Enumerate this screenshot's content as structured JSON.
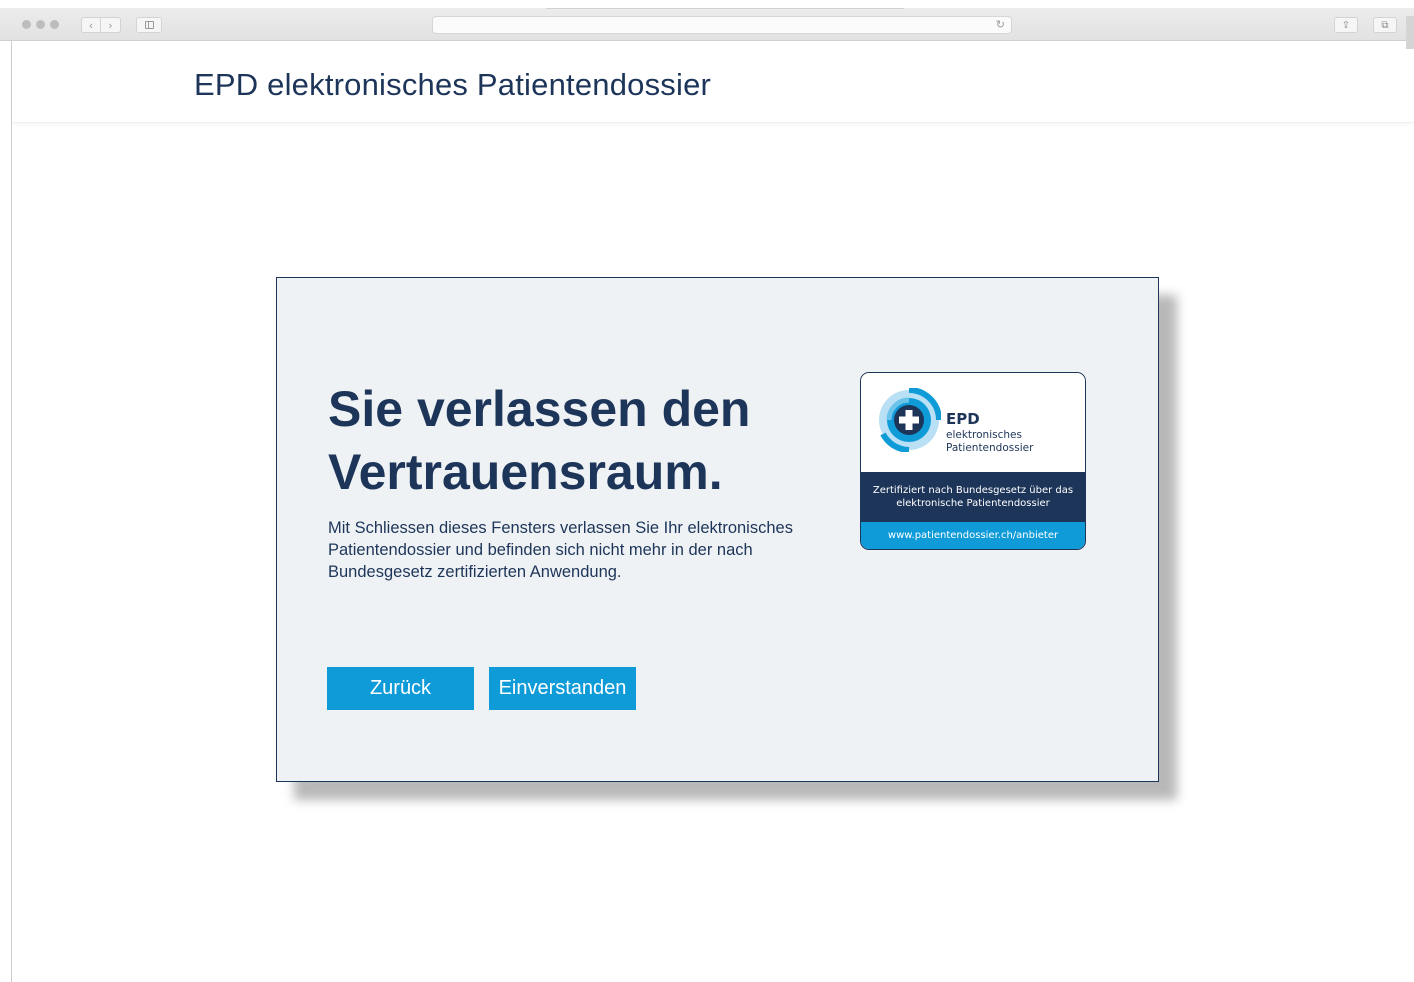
{
  "browser": {
    "back_glyph": "‹",
    "forward_glyph": "›",
    "reload_glyph": "↻",
    "share_glyph": "⇪",
    "tabs_glyph": "⧉",
    "icons": [
      "traffic-lights",
      "back-icon",
      "forward-icon",
      "sidebar-icon",
      "reload-icon",
      "share-icon",
      "tabs-icon"
    ]
  },
  "header": {
    "title": "EPD elektronisches Patientendossier"
  },
  "dialog": {
    "title": "Sie verlassen den Vertrauensraum.",
    "body": "Mit Schliessen dieses Fensters verlassen Sie Ihr elektronisches Patientendossier und befinden sich nicht mehr in der nach Bundesgesetz zertifizierten Anwendung.",
    "buttons": {
      "back": "Zurück",
      "accept": "Einverstanden"
    }
  },
  "badge": {
    "brand": "EPD",
    "subtitle": "elektronisches Patientendossier",
    "certification": "Zertifiziert nach Bundesgesetz über das elektronische Patientendossier",
    "url": "www.patientendossier.ch/anbieter",
    "logo_icon": "epd-cross-logo-icon"
  },
  "colors": {
    "navy": "#1d3559",
    "accent_blue": "#0e9bd8",
    "dialog_bg": "#eff2f5"
  }
}
